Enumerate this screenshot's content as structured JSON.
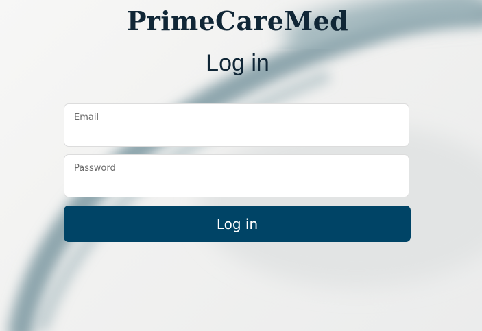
{
  "brand": {
    "name": "PrimeCareMed"
  },
  "login": {
    "heading": "Log in",
    "email": {
      "label": "Email",
      "value": "",
      "placeholder": ""
    },
    "password": {
      "label": "Password",
      "value": "",
      "placeholder": ""
    },
    "submit_label": "Log in"
  },
  "theme": {
    "primary": "#004466",
    "text": "#102636",
    "background_image": "blurred-stethoscope-photo"
  }
}
